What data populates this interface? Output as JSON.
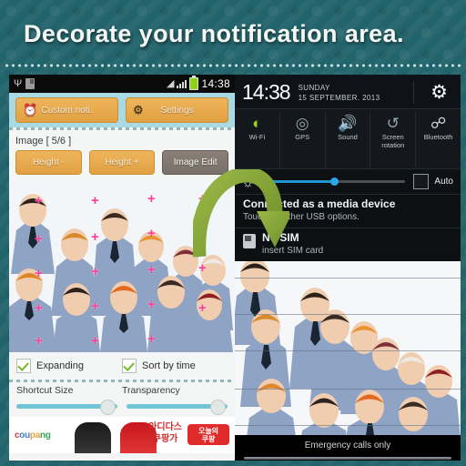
{
  "headline": "Decorate your notification area.",
  "theme": {
    "background_teal": "#22646b",
    "accent_orange": "#e2a042",
    "panel_cyan": "#a9dae3",
    "toggle_green": "#9fd418",
    "slider_blue": "#2196d3",
    "crop_mark_pink": "#ff3d9a"
  },
  "left_phone": {
    "status_bar": {
      "icons_left": [
        "usb-icon",
        "sd-card-icon"
      ],
      "icons_right": [
        "wifi-icon",
        "signal-icon",
        "battery-icon"
      ],
      "time": "14:38"
    },
    "toolbar": {
      "custom_noti_label": "Custom noti.",
      "custom_noti_icon": "alarm-clock-icon",
      "settings_label": "Settings",
      "settings_icon": "gear-icon"
    },
    "image_section": {
      "label": "Image  [ 5/6 ]",
      "height_minus_label": "Height -",
      "height_plus_label": "Height +",
      "image_edit_label": "Image Edit"
    },
    "options": {
      "expanding_label": "Expanding",
      "expanding_checked": true,
      "sort_by_time_label": "Sort by time",
      "sort_by_time_checked": true,
      "shortcut_size_label": "Shortcut Size",
      "transparency_label": "Transparency",
      "shortcut_size_value": 88,
      "transparency_value": 88
    },
    "ad": {
      "logo": "coupang",
      "korean_line1": "아디다스",
      "korean_line2": "쿠팡가",
      "button_line1": "오늘의",
      "button_line2": "쿠팡"
    }
  },
  "right_phone": {
    "shade": {
      "time": "14:38",
      "day": "SUNDAY",
      "date": "15 SEPTEMBER. 2013",
      "settings_icon": "gear-icon"
    },
    "toggles": [
      {
        "label": "Wi-Fi",
        "icon": "wifi-icon",
        "on": true
      },
      {
        "label": "GPS",
        "icon": "gps-icon",
        "on": false
      },
      {
        "label": "Sound",
        "icon": "sound-icon",
        "on": true
      },
      {
        "label": "Screen rotation",
        "icon": "rotate-icon",
        "on": false
      },
      {
        "label": "Bluetooth",
        "icon": "bluetooth-icon",
        "on": false
      }
    ],
    "brightness": {
      "icon": "brightness-icon",
      "value": 50,
      "auto_label": "Auto",
      "auto_checked": false
    },
    "notifications": [
      {
        "title": "Connected as a media device",
        "subtitle": "Touch for other USB options.",
        "icon": "usb-icon"
      },
      {
        "title": "No SIM",
        "subtitle": "insert SIM card",
        "icon": "sim-card-icon"
      }
    ],
    "footer": "Emergency calls only"
  },
  "overlay": {
    "arrow_icon": "curved-arrow-icon",
    "arrow_color": "#7a9e32"
  }
}
